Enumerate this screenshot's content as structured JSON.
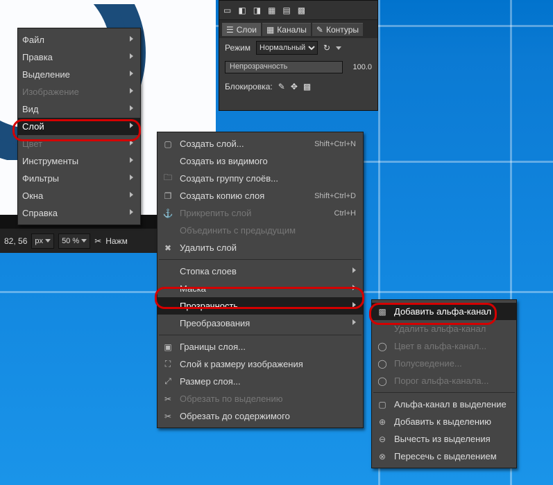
{
  "desktop": {
    "os_hint": "Windows 10"
  },
  "editor": {
    "hint_text": "Нажм",
    "coords": "82, 56",
    "unit": "px",
    "zoom": "50 %"
  },
  "dock": {
    "tabs": {
      "layers": "Слои",
      "channels": "Каналы",
      "paths": "Контуры"
    },
    "mode_label": "Режим",
    "mode_value": "Нормальный",
    "opacity_label": "Непрозрачность",
    "opacity_value": "100.0",
    "lock_label": "Блокировка:"
  },
  "main_menu": {
    "file": "Файл",
    "edit": "Правка",
    "select": "Выделение",
    "image": "Изображение",
    "view": "Вид",
    "layer": "Слой",
    "color": "Цвет",
    "tools": "Инструменты",
    "filters": "Фильтры",
    "windows": "Окна",
    "help": "Справка"
  },
  "layer_menu": {
    "new_layer": "Создать слой...",
    "new_from_visible": "Создать из видимого",
    "new_group": "Создать группу слоёв...",
    "duplicate": "Создать копию слоя",
    "anchor": "Прикрепить слой",
    "merge_down": "Объединить с предыдущим",
    "delete": "Удалить слой",
    "stack": "Стопка слоев",
    "mask": "Маска",
    "transparency": "Прозрачность",
    "transform": "Преобразования",
    "boundary": "Границы слоя...",
    "to_image_size": "Слой к размеру изображения",
    "scale": "Размер слоя...",
    "crop_selection": "Обрезать по выделению",
    "crop_content": "Обрезать до содержимого",
    "accel_new": "Shift+Ctrl+N",
    "accel_dup": "Shift+Ctrl+D",
    "accel_anchor": "Ctrl+H"
  },
  "trans_menu": {
    "add_alpha": "Добавить альфа-канал",
    "remove_alpha": "Удалить альфа-канал",
    "color_to_alpha": "Цвет в альфа-канал...",
    "semi_flat": "Полусведение...",
    "threshold": "Порог альфа-канала...",
    "alpha_to_sel": "Альфа-канал в выделение",
    "add_to_sel": "Добавить к выделению",
    "sub_from_sel": "Вычесть из выделения",
    "intersect": "Пересечь с выделением"
  }
}
